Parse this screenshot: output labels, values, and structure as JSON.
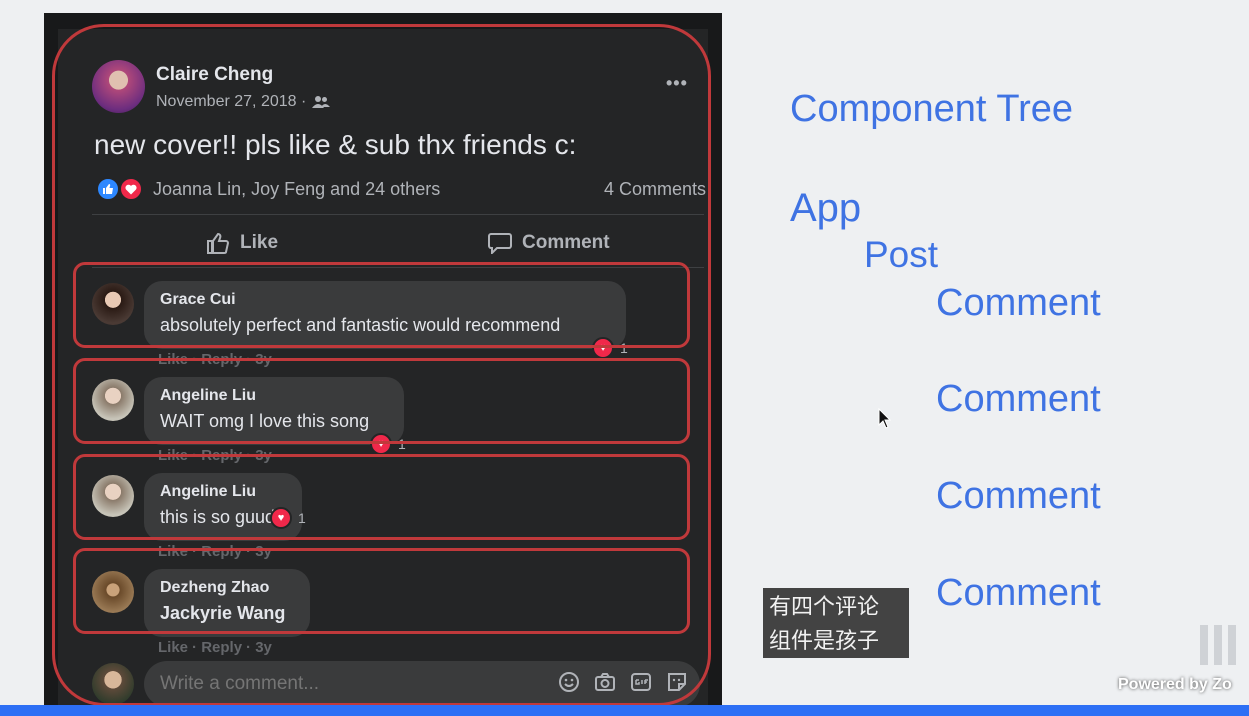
{
  "post": {
    "author": "Claire Cheng",
    "date": "November 27, 2018 ·",
    "text": "new cover!! pls like & sub thx friends c:",
    "reactors": "Joanna Lin, Joy Feng and 24 others",
    "comment_count": "4 Comments",
    "like_label": "Like",
    "comment_label": "Comment"
  },
  "comments": [
    {
      "name": "Grace Cui",
      "text": "absolutely perfect and fantastic would recommend",
      "reaction_count": "1",
      "meta": [
        "Like",
        "Reply",
        "3y"
      ]
    },
    {
      "name": "Angeline Liu",
      "text": "WAIT omg I love this song",
      "reaction_count": "1",
      "meta": [
        "Like",
        "Reply",
        "3y"
      ]
    },
    {
      "name": "Angeline Liu",
      "text": "this is so guud",
      "reaction_count": "1",
      "meta": [
        "Like",
        "Reply",
        "3y"
      ]
    },
    {
      "name": "Dezheng Zhao",
      "text": "Jackyrie Wang",
      "reaction_count": "",
      "meta": [
        "Like",
        "Reply",
        "3y"
      ]
    }
  ],
  "write_comment": {
    "placeholder": "Write a comment..."
  },
  "tree": {
    "title": "Component Tree",
    "app": "App",
    "post": "Post",
    "comments": [
      "Comment",
      "Comment",
      "Comment",
      "Comment"
    ]
  },
  "subtitle": {
    "line1": "有四个评论",
    "line2": "组件是孩子"
  },
  "watermark": {
    "powered": "Powered by Zo"
  },
  "colors": {
    "annotation_red": "#c0393b",
    "tree_blue": "#3f73e3",
    "fb_dark": "#242526"
  }
}
